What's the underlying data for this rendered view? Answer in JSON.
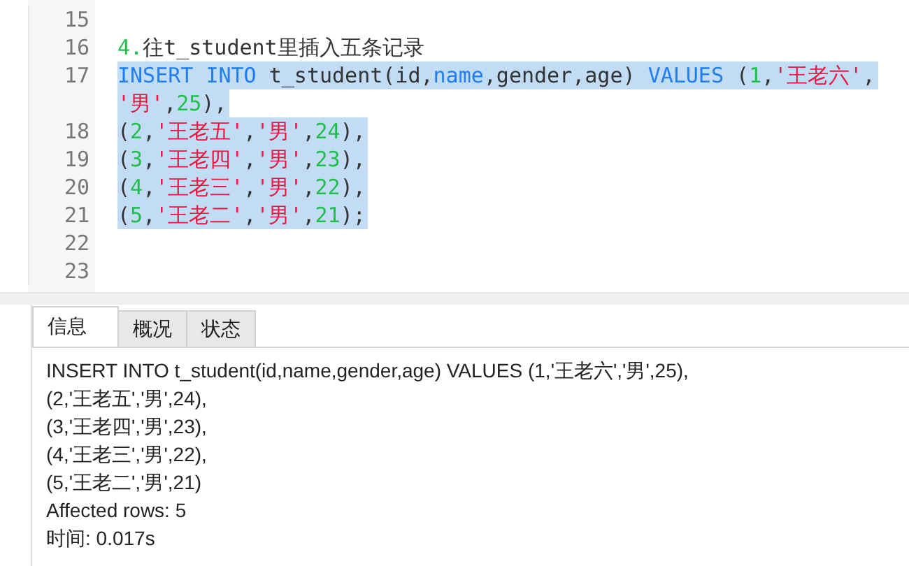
{
  "editor": {
    "lines": [
      {
        "number": "15",
        "selected": false
      },
      {
        "number": "16",
        "selected": false,
        "rows": [
          {
            "tokens": [
              {
                "kind": "number",
                "text": "4."
              },
              {
                "kind": "plain",
                "text": "往t_student里插入五条记录"
              }
            ]
          }
        ]
      },
      {
        "number": "17",
        "selected": true,
        "rows": [
          {
            "tokens": [
              {
                "kind": "keyword",
                "text": "INSERT INTO"
              },
              {
                "kind": "plain",
                "text": " t_student(id,"
              },
              {
                "kind": "keyword",
                "text": "name"
              },
              {
                "kind": "plain",
                "text": ",gender,age) "
              },
              {
                "kind": "keyword",
                "text": "VALUES"
              },
              {
                "kind": "plain",
                "text": " ("
              },
              {
                "kind": "number",
                "text": "1"
              },
              {
                "kind": "plain",
                "text": ","
              },
              {
                "kind": "string",
                "text": "'王老六'"
              },
              {
                "kind": "plain",
                "text": ","
              }
            ]
          },
          {
            "tokens": [
              {
                "kind": "string",
                "text": "'男'"
              },
              {
                "kind": "plain",
                "text": ","
              },
              {
                "kind": "number",
                "text": "25"
              },
              {
                "kind": "plain",
                "text": "),"
              }
            ]
          }
        ]
      },
      {
        "number": "18",
        "selected": true,
        "rows": [
          {
            "tokens": [
              {
                "kind": "plain",
                "text": "("
              },
              {
                "kind": "number",
                "text": "2"
              },
              {
                "kind": "plain",
                "text": ","
              },
              {
                "kind": "string",
                "text": "'王老五'"
              },
              {
                "kind": "plain",
                "text": ","
              },
              {
                "kind": "string",
                "text": "'男'"
              },
              {
                "kind": "plain",
                "text": ","
              },
              {
                "kind": "number",
                "text": "24"
              },
              {
                "kind": "plain",
                "text": "),"
              }
            ]
          }
        ]
      },
      {
        "number": "19",
        "selected": true,
        "rows": [
          {
            "tokens": [
              {
                "kind": "plain",
                "text": "("
              },
              {
                "kind": "number",
                "text": "3"
              },
              {
                "kind": "plain",
                "text": ","
              },
              {
                "kind": "string",
                "text": "'王老四'"
              },
              {
                "kind": "plain",
                "text": ","
              },
              {
                "kind": "string",
                "text": "'男'"
              },
              {
                "kind": "plain",
                "text": ","
              },
              {
                "kind": "number",
                "text": "23"
              },
              {
                "kind": "plain",
                "text": "),"
              }
            ]
          }
        ]
      },
      {
        "number": "20",
        "selected": true,
        "rows": [
          {
            "tokens": [
              {
                "kind": "plain",
                "text": "("
              },
              {
                "kind": "number",
                "text": "4"
              },
              {
                "kind": "plain",
                "text": ","
              },
              {
                "kind": "string",
                "text": "'王老三'"
              },
              {
                "kind": "plain",
                "text": ","
              },
              {
                "kind": "string",
                "text": "'男'"
              },
              {
                "kind": "plain",
                "text": ","
              },
              {
                "kind": "number",
                "text": "22"
              },
              {
                "kind": "plain",
                "text": "),"
              }
            ]
          }
        ]
      },
      {
        "number": "21",
        "selected": true,
        "rows": [
          {
            "tokens": [
              {
                "kind": "plain",
                "text": "("
              },
              {
                "kind": "number",
                "text": "5"
              },
              {
                "kind": "plain",
                "text": ","
              },
              {
                "kind": "string",
                "text": "'王老二'"
              },
              {
                "kind": "plain",
                "text": ","
              },
              {
                "kind": "string",
                "text": "'男'"
              },
              {
                "kind": "plain",
                "text": ","
              },
              {
                "kind": "number",
                "text": "21"
              },
              {
                "kind": "plain",
                "text": ");"
              }
            ]
          }
        ]
      },
      {
        "number": "22",
        "selected": false
      },
      {
        "number": "23",
        "selected": false
      }
    ]
  },
  "tabs": [
    {
      "label": "信息",
      "selected": true
    },
    {
      "label": "概况",
      "selected": false
    },
    {
      "label": "状态",
      "selected": false
    }
  ],
  "messages": [
    "INSERT INTO t_student(id,name,gender,age) VALUES (1,'王老六','男',25),",
    "(2,'王老五','男',24),",
    "(3,'王老四','男',23),",
    "(4,'王老三','男',22),",
    "(5,'王老二','男',21)",
    "Affected rows: 5",
    "时间: 0.017s"
  ]
}
